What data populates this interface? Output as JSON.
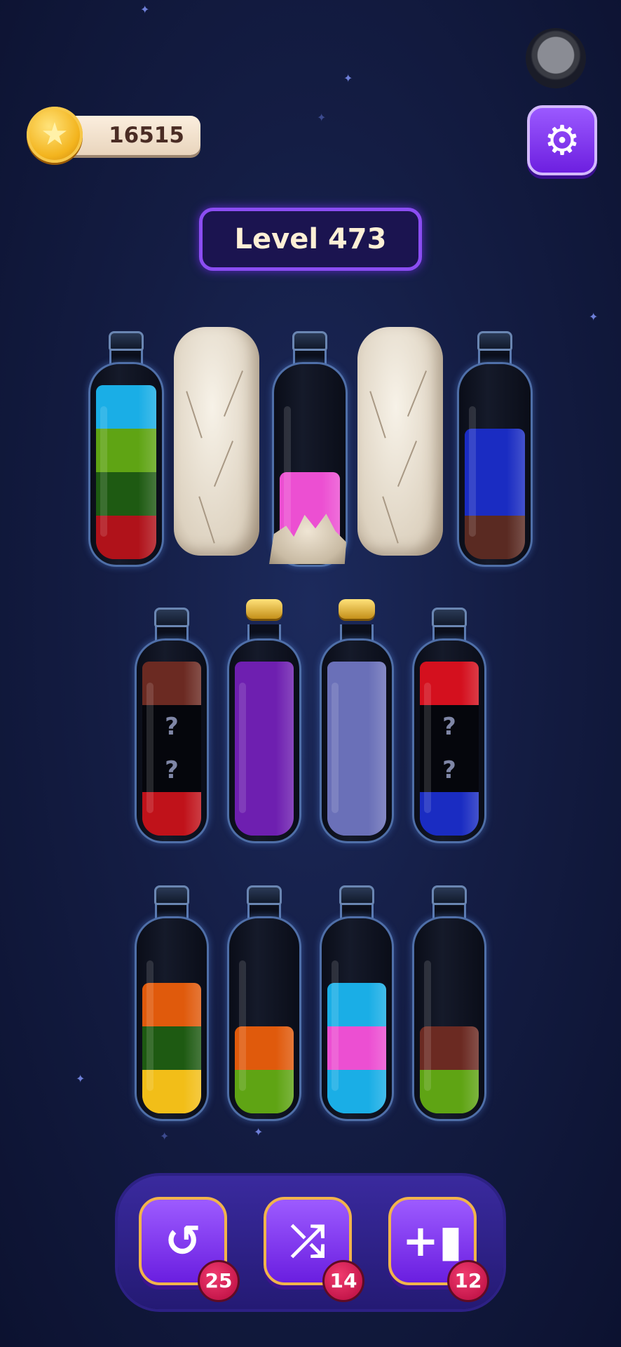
{
  "hud": {
    "coins": "16515",
    "coin_icon": "star-coin-icon",
    "settings_icon": "gear-icon",
    "level_label": "Level 473"
  },
  "rows": [
    [
      {
        "type": "tube",
        "layers": [
          {
            "color": "#1aaee6"
          },
          {
            "color": "#5fa414"
          },
          {
            "color": "#1e5a12"
          },
          {
            "color": "#b0121a"
          }
        ]
      },
      {
        "type": "stone"
      },
      {
        "type": "tube",
        "rocks": true,
        "layers": [
          {
            "color": "#ec4fd2"
          },
          {
            "color": "#ec4fd2"
          }
        ]
      },
      {
        "type": "stone"
      },
      {
        "type": "tube",
        "layers": [
          {
            "color": "#1a2cc2"
          },
          {
            "color": "#1a2cc2"
          },
          {
            "color": "#5a2a22"
          }
        ]
      }
    ],
    [
      {
        "type": "tube",
        "layers": [
          {
            "color": "#6b2a22"
          },
          {
            "hidden": true,
            "label": "?"
          },
          {
            "hidden": true,
            "label": "?"
          },
          {
            "color": "#c0121a"
          }
        ]
      },
      {
        "type": "tube",
        "cork": true,
        "layers": [
          {
            "color": "#6e1fb0"
          },
          {
            "color": "#6e1fb0"
          },
          {
            "color": "#6e1fb0"
          },
          {
            "color": "#6e1fb0"
          }
        ]
      },
      {
        "type": "tube",
        "cork": true,
        "layers": [
          {
            "color": "#6a70b8"
          },
          {
            "color": "#6a70b8"
          },
          {
            "color": "#6a70b8"
          },
          {
            "color": "#6a70b8"
          }
        ]
      },
      {
        "type": "tube",
        "layers": [
          {
            "color": "#d4101e"
          },
          {
            "hidden": true,
            "label": "?"
          },
          {
            "hidden": true,
            "label": "?"
          },
          {
            "color": "#1a2cc2"
          }
        ]
      }
    ],
    [
      {
        "type": "tube",
        "layers": [
          {
            "color": "#e05a0c"
          },
          {
            "color": "#1e5a12"
          },
          {
            "color": "#f2be18"
          }
        ]
      },
      {
        "type": "tube",
        "layers": [
          {
            "color": "#e05a0c"
          },
          {
            "color": "#5fa414"
          }
        ]
      },
      {
        "type": "tube",
        "layers": [
          {
            "color": "#1aaee6"
          },
          {
            "color": "#ec4fd2"
          },
          {
            "color": "#1aaee6"
          }
        ]
      },
      {
        "type": "tube",
        "layers": [
          {
            "color": "#6b2a22"
          },
          {
            "color": "#5fa414"
          }
        ]
      }
    ]
  ],
  "powerups": [
    {
      "name": "undo-button",
      "icon": "undo-icon",
      "glyph": "↺",
      "count": "25"
    },
    {
      "name": "shuffle-button",
      "icon": "shuffle-icon",
      "glyph": "⤮",
      "count": "14"
    },
    {
      "name": "add-tube-button",
      "icon": "add-bottle-icon",
      "glyph": "+▮",
      "count": "12"
    }
  ]
}
